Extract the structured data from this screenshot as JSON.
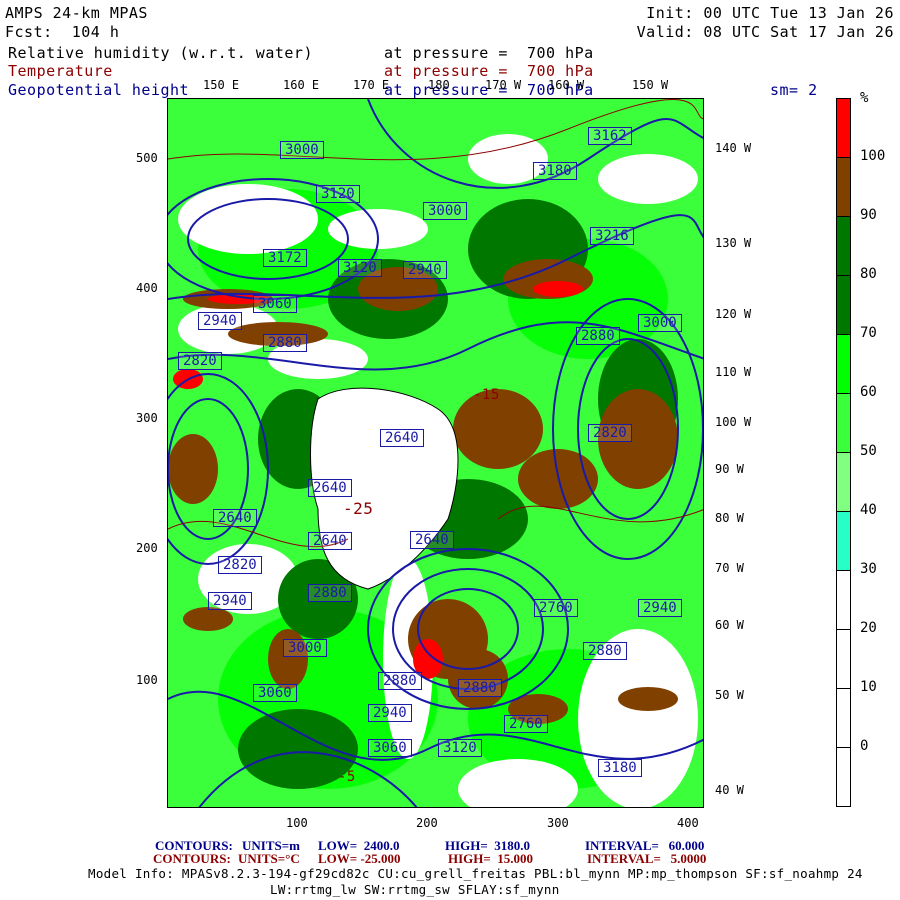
{
  "header": {
    "model": "AMPS 24-km MPAS",
    "init": "Init: 00 UTC Tue 13 Jan 26",
    "fcst": "Fcst:  104 h",
    "valid": "Valid: 08 UTC Sat 17 Jan 26",
    "field1": "Relative humidity (w.r.t. water)",
    "field1_level": "at pressure =  700 hPa",
    "field2": "Temperature",
    "field2_level": "at pressure =  700 hPa",
    "field3": "Geopotential height",
    "field3_level": "at pressure =  700 hPa",
    "smoothing": "sm= 2"
  },
  "axes": {
    "left": [
      "500",
      "400",
      "300",
      "200",
      "100"
    ],
    "bottom": [
      "100",
      "200",
      "300",
      "400"
    ],
    "top_lon": [
      "150 E",
      "160 E",
      "170 E",
      "180",
      "170 W",
      "160 W",
      "150 W"
    ],
    "right_lon": [
      "140 W",
      "130 W",
      "120 W",
      "110 W",
      "100 W",
      "90 W",
      "80 W",
      "70 W",
      "60 W",
      "50 W",
      "40 W"
    ]
  },
  "colorbar": {
    "unit": "%",
    "labels": [
      "100",
      "90",
      "80",
      "70",
      "60",
      "50",
      "40",
      "30",
      "20",
      "10",
      "0"
    ],
    "colors": [
      "#ff0000",
      "#804000",
      "#007800",
      "#007800",
      "#00ff00",
      "#3cff3c",
      "#80ff80",
      "#28ffc8",
      "#ffffff",
      "#ffffff",
      "#ffffff",
      "#ffffff"
    ]
  },
  "contour_labels": [
    "3162",
    "3180",
    "3000",
    "3120",
    "3216",
    "3172",
    "3000",
    "3120",
    "2940",
    "3060",
    "2940",
    "2880",
    "2820",
    "2880",
    "3000",
    "2640",
    "2640",
    "2640",
    "2640",
    "2640",
    "2820",
    "2940",
    "2880",
    "2820",
    "2940",
    "2760",
    "3000",
    "3060",
    "2880",
    "2940",
    "3120",
    "3060",
    "3180",
    "2880",
    "2760",
    "2880"
  ],
  "temp_labels": [
    "-25",
    "-15",
    "-5"
  ],
  "footer": {
    "line1": {
      "label": "CONTOURS:",
      "units": "UNITS=m",
      "low": "LOW=  2400.0",
      "high": "HIGH=  3180.0",
      "interval": "INTERVAL=   60.000"
    },
    "line2": {
      "label": "CONTOURS:",
      "units": "UNITS=°C",
      "low": "LOW= -25.000",
      "high": "HIGH=  15.000",
      "interval": "INTERVAL=   5.0000"
    },
    "model_info": "Model Info: MPASv8.2.3-194-gf29cd82c CU:cu_grell_freitas PBL:bl_mynn MP:mp_thompson SF:sf_noahmp 24",
    "model_info2": "LW:rrtmg_lw SW:rrtmg_sw SFLAY:sf_mynn"
  }
}
